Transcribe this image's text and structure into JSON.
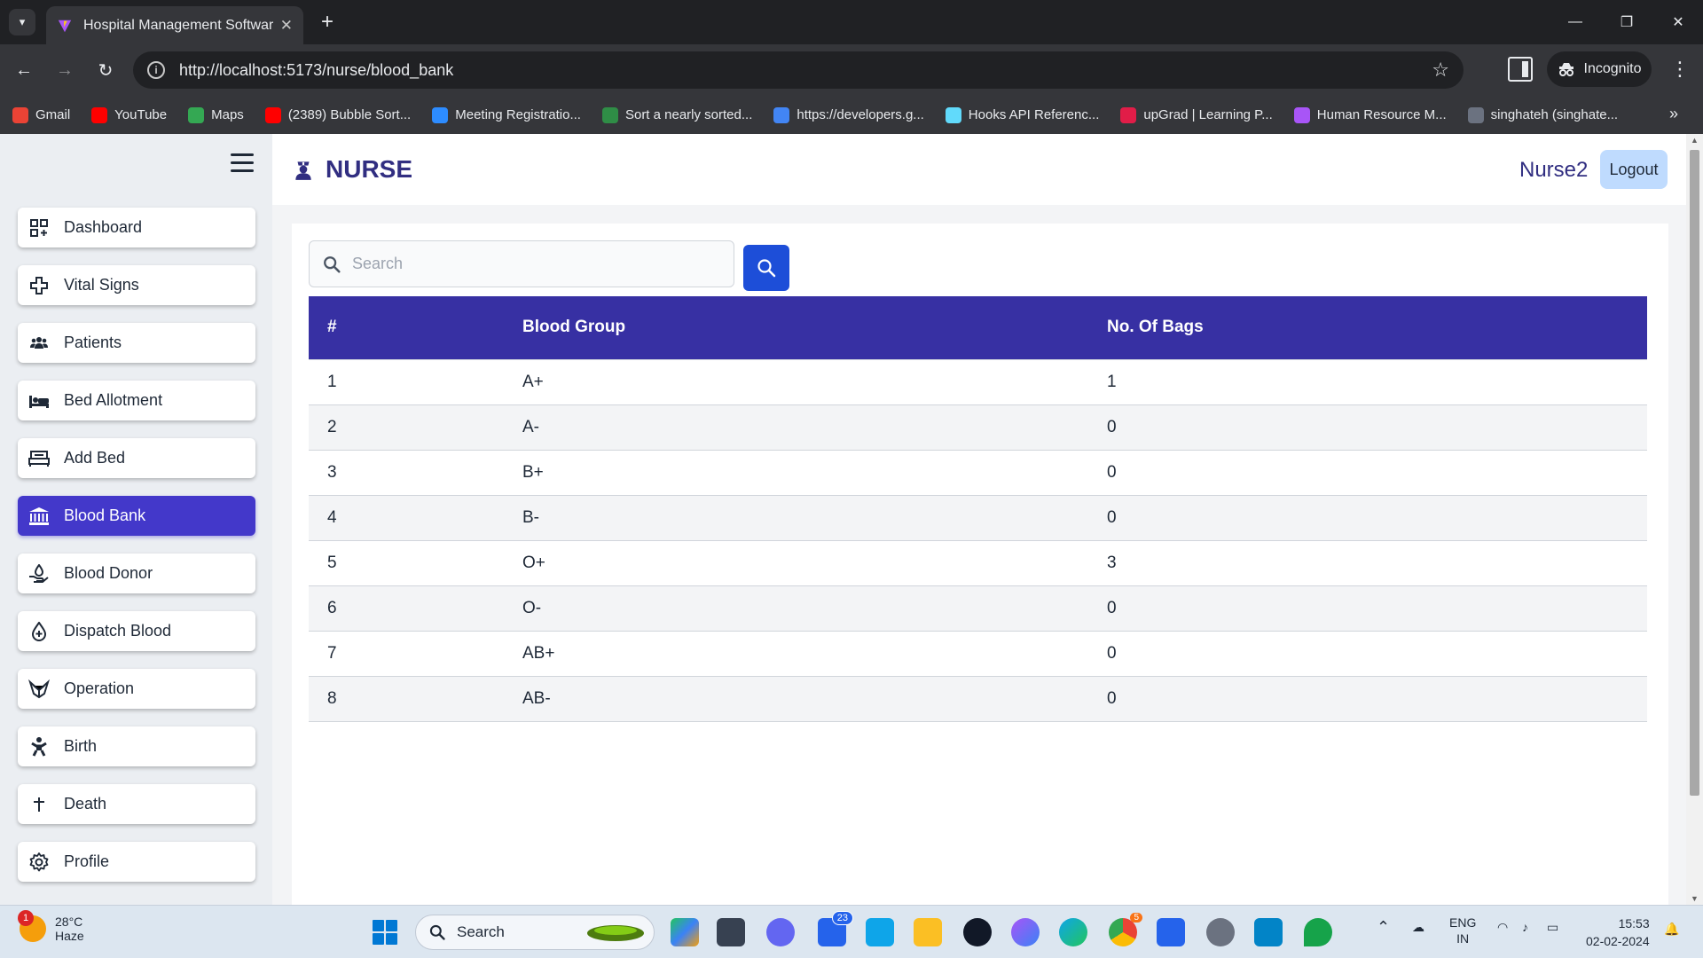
{
  "browser": {
    "tab_title": "Hospital Management Software",
    "url": "http://localhost:5173/nurse/blood_bank",
    "incognito_label": "Incognito",
    "bookmarks": [
      {
        "label": "Gmail",
        "icon": "gmail-icon",
        "color": "#ea4335"
      },
      {
        "label": "YouTube",
        "icon": "youtube-icon",
        "color": "#ff0000"
      },
      {
        "label": "Maps",
        "icon": "maps-icon",
        "color": "#34a853"
      },
      {
        "label": "(2389) Bubble Sort...",
        "icon": "youtube-icon",
        "color": "#ff0000"
      },
      {
        "label": "Meeting Registratio...",
        "icon": "zoom-icon",
        "color": "#2d8cff"
      },
      {
        "label": "Sort a nearly sorted...",
        "icon": "gfg-icon",
        "color": "#2f8d46"
      },
      {
        "label": "https://developers.g...",
        "icon": "google-icon",
        "color": "#4285f4"
      },
      {
        "label": "Hooks API Referenc...",
        "icon": "react-icon",
        "color": "#61dafb"
      },
      {
        "label": "upGrad | Learning P...",
        "icon": "upgrad-icon",
        "color": "#e11d48"
      },
      {
        "label": "Human Resource M...",
        "icon": "hr-icon",
        "color": "#a855f7"
      },
      {
        "label": "singhateh (singhate...",
        "icon": "github-icon",
        "color": "#6b7280"
      }
    ]
  },
  "app": {
    "brand": "NURSE",
    "user": "Nurse2",
    "logout_label": "Logout",
    "accent_color": "#4338ca",
    "header_color": "#3730a3",
    "menu": [
      {
        "label": "Dashboard",
        "icon": "dashboard-icon",
        "active": false
      },
      {
        "label": "Vital Signs",
        "icon": "medical-cross-icon",
        "active": false
      },
      {
        "label": "Patients",
        "icon": "users-icon",
        "active": false
      },
      {
        "label": "Bed Allotment",
        "icon": "bed-icon",
        "active": false
      },
      {
        "label": "Add Bed",
        "icon": "bed-frame-icon",
        "active": false
      },
      {
        "label": "Blood Bank",
        "icon": "bank-icon",
        "active": true
      },
      {
        "label": "Blood Donor",
        "icon": "hand-donate-icon",
        "active": false
      },
      {
        "label": "Dispatch Blood",
        "icon": "blood-drop-icon",
        "active": false
      },
      {
        "label": "Operation",
        "icon": "operation-icon",
        "active": false
      },
      {
        "label": "Birth",
        "icon": "baby-icon",
        "active": false
      },
      {
        "label": "Death",
        "icon": "cross-icon",
        "active": false
      },
      {
        "label": "Profile",
        "icon": "gear-icon",
        "active": false
      }
    ],
    "search": {
      "placeholder": "Search",
      "value": ""
    },
    "table": {
      "headers": [
        "#",
        "Blood Group",
        "No. Of Bags"
      ],
      "rows": [
        [
          "1",
          "A+",
          "1"
        ],
        [
          "2",
          "A-",
          "0"
        ],
        [
          "3",
          "B+",
          "0"
        ],
        [
          "4",
          "B-",
          "0"
        ],
        [
          "5",
          "O+",
          "3"
        ],
        [
          "6",
          "O-",
          "0"
        ],
        [
          "7",
          "AB+",
          "0"
        ],
        [
          "8",
          "AB-",
          "0"
        ]
      ]
    }
  },
  "taskbar": {
    "temperature": "28°C",
    "weather": "Haze",
    "weather_badge": "1",
    "search_label": "Search",
    "mail_badge": "23",
    "chrome_badge": "5",
    "lang_top": "ENG",
    "lang_bottom": "IN",
    "time": "15:53",
    "date": "02-02-2024"
  }
}
